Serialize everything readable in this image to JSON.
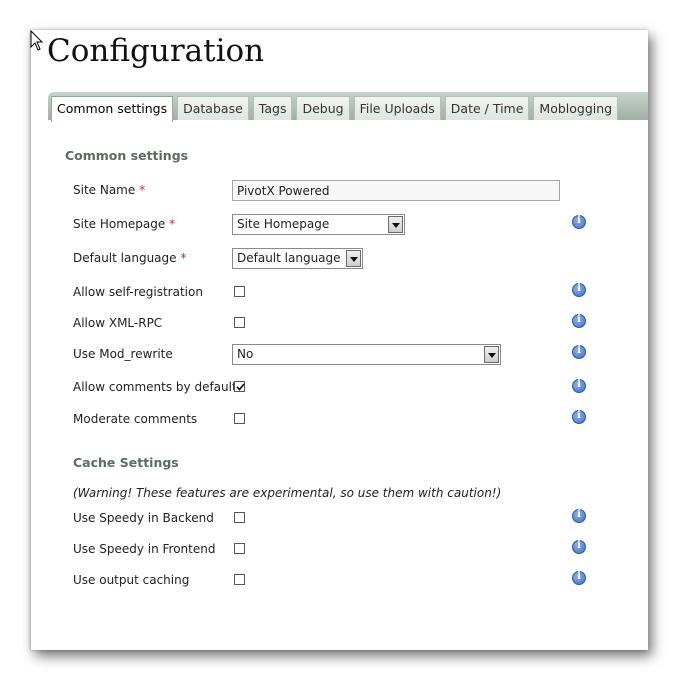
{
  "page": {
    "title": "Configuration"
  },
  "tabs": [
    {
      "label": "Common settings",
      "active": true
    },
    {
      "label": "Database"
    },
    {
      "label": "Tags"
    },
    {
      "label": "Debug"
    },
    {
      "label": "File Uploads"
    },
    {
      "label": "Date / Time"
    },
    {
      "label": "Moblogging"
    }
  ],
  "common": {
    "heading": "Common settings",
    "site_name": {
      "label": "Site Name",
      "required_mark": "*",
      "value": "PivotX Powered"
    },
    "site_homepage": {
      "label": "Site Homepage",
      "required_mark": "*",
      "value": "Site Homepage"
    },
    "default_language": {
      "label": "Default language",
      "required_mark": "*",
      "value": "Default language"
    },
    "allow_self_registration": {
      "label": "Allow self-registration",
      "checked": false
    },
    "allow_xml_rpc": {
      "label": "Allow XML-RPC",
      "checked": false
    },
    "use_mod_rewrite": {
      "label": "Use Mod_rewrite",
      "value": "No"
    },
    "allow_comments_default": {
      "label": "Allow comments by default",
      "checked": true
    },
    "moderate_comments": {
      "label": "Moderate comments",
      "checked": false
    }
  },
  "cache": {
    "heading": "Cache Settings",
    "warning": "(Warning! These features are experimental, so use them with caution!)",
    "speedy_backend": {
      "label": "Use Speedy in Backend",
      "checked": false
    },
    "speedy_frontend": {
      "label": "Use Speedy in Frontend",
      "checked": false
    },
    "output_caching": {
      "label": "Use output caching",
      "checked": false
    }
  },
  "colors": {
    "tab_bar": "#9fb0a6",
    "section_heading": "#5d6b61",
    "required": "#c0282e",
    "info_icon": "#3f6fc6"
  }
}
